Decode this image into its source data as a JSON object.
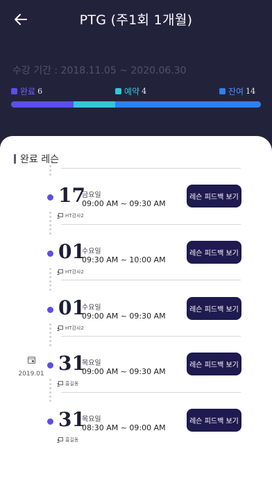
{
  "header": {
    "title": "PTG (주1회 1개월)",
    "period": "수강 기간 : 2018.11.05 ~ 2020.06.30"
  },
  "legend": [
    {
      "label": "완료",
      "count": "6",
      "color": "#5a4fe8"
    },
    {
      "label": "예약",
      "count": "4",
      "color": "#36c6d6"
    },
    {
      "label": "잔여",
      "count": "14",
      "color": "#2f7ff0"
    }
  ],
  "progress": {
    "completed": 6,
    "reserved": 4,
    "remaining": 14,
    "total": 24
  },
  "section": {
    "title": "완료 레슨"
  },
  "month_marker": {
    "label": "2019.01"
  },
  "lessons": [
    {
      "day": "17",
      "weekday": "금요일",
      "time": "09:00 AM ~ 09:30 AM",
      "teacher": "HT강사2",
      "button": "레슨 피드백 보기"
    },
    {
      "day": "01",
      "weekday": "수요일",
      "time": "09:30 AM ~ 10:00 AM",
      "teacher": "HT강사2",
      "button": "레슨 피드백 보기"
    },
    {
      "day": "01",
      "weekday": "수요일",
      "time": "09:00 AM ~ 09:30 AM",
      "teacher": "HT강사2",
      "button": "레슨 피드백 보기"
    },
    {
      "day": "31",
      "weekday": "목요일",
      "time": "09:00 AM ~ 09:30 AM",
      "teacher": "홍길동",
      "button": "레슨 피드백 보기"
    },
    {
      "day": "31",
      "weekday": "목요일",
      "time": "08:30 AM ~ 09:00 AM",
      "teacher": "홍길동",
      "button": "레슨 피드백 보기"
    }
  ],
  "icons": {
    "back": "arrow-left-icon",
    "teacher": "board-person-icon",
    "calendar": "calendar-icon"
  }
}
